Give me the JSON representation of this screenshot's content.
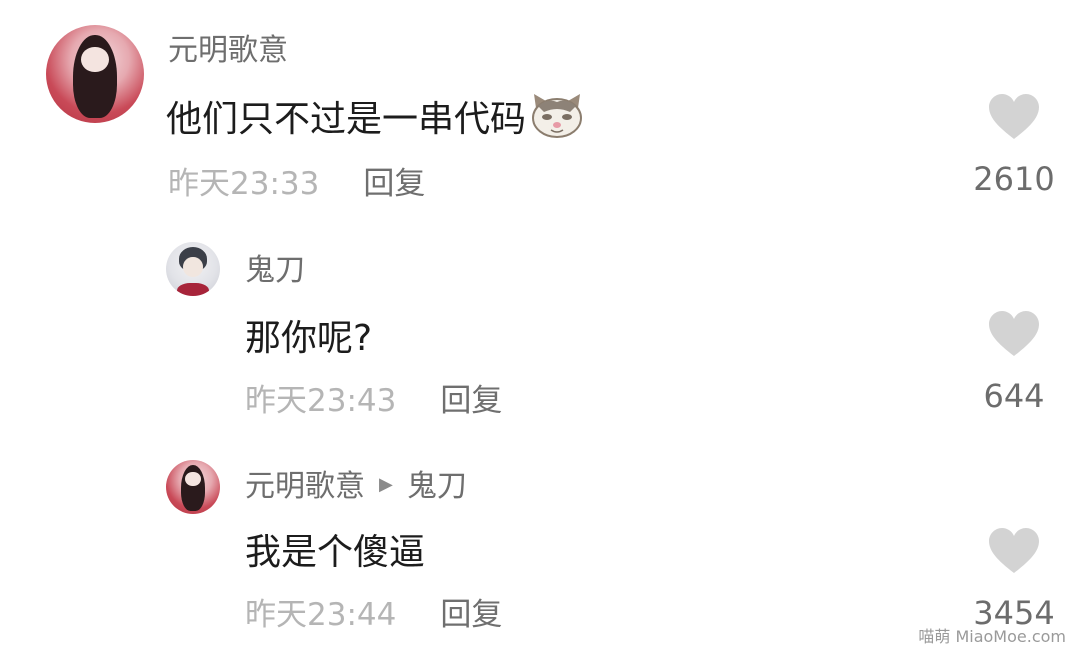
{
  "comments": [
    {
      "username": "元明歌意",
      "text": "他们只不过是一串代码",
      "emoji": "cat-face-emoji",
      "time": "昨天23:33",
      "reply_label": "回复",
      "likes": "2610"
    },
    {
      "username": "鬼刀",
      "text": "那你呢?",
      "time": "昨天23:43",
      "reply_label": "回复",
      "likes": "644"
    },
    {
      "username": "元明歌意",
      "reply_to": "鬼刀",
      "text": "我是个傻逼",
      "time": "昨天23:44",
      "reply_label": "回复",
      "likes": "3454"
    }
  ],
  "watermark": "喵萌 MiaoMoe.com",
  "colors": {
    "username": "#6e6e6e",
    "timestamp": "#b5b5b5",
    "reply": "#6f6f6f",
    "heart": "#d3d3d3"
  }
}
